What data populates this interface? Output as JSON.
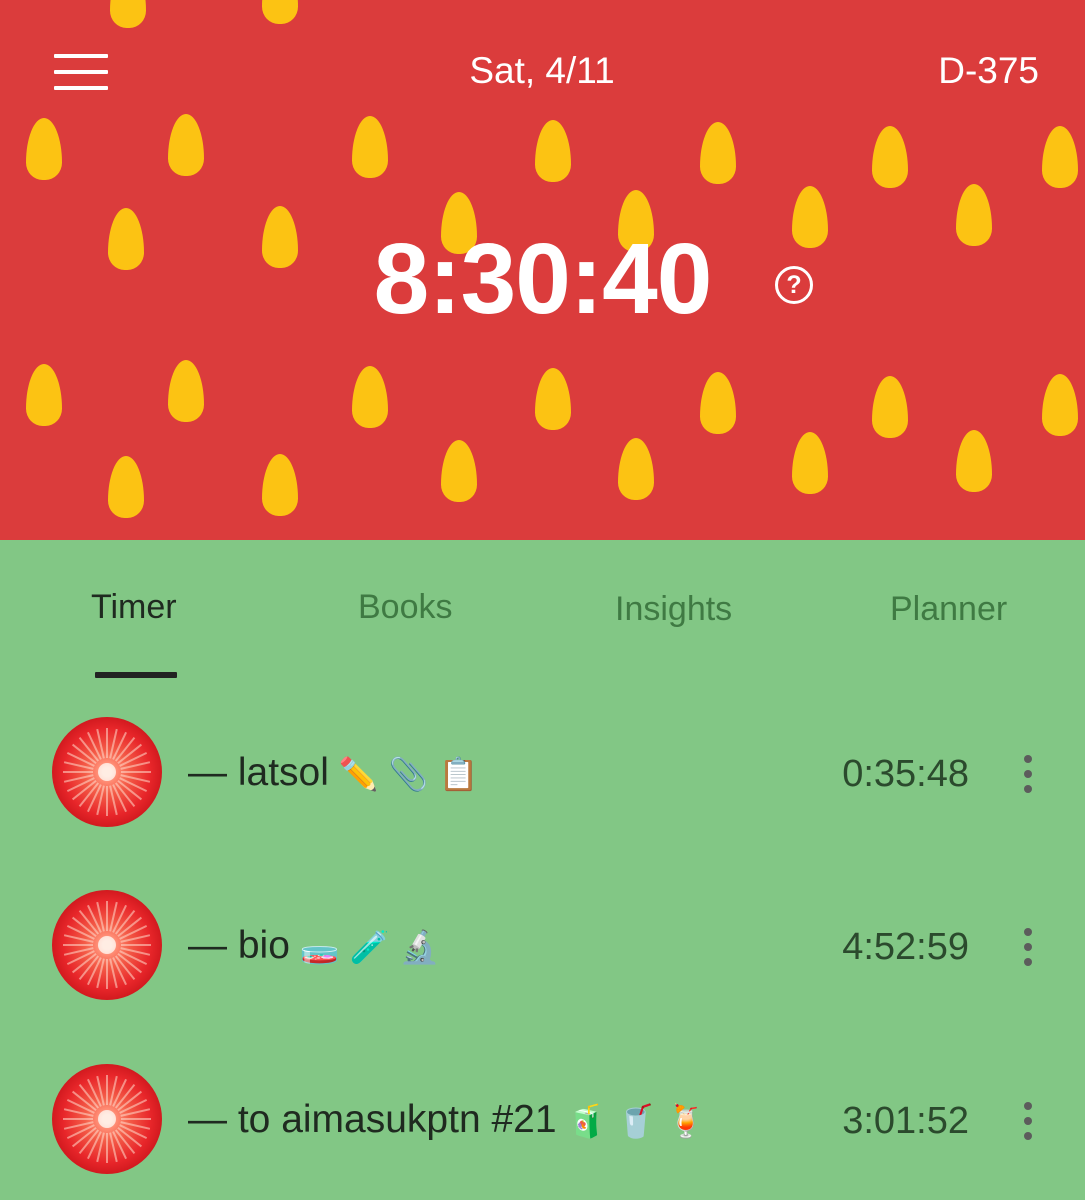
{
  "header": {
    "date": "Sat, 4/11",
    "dday": "D-375",
    "timer": "8:30:40",
    "help_glyph": "?",
    "background_color": "#db3c3c",
    "seed_color": "#fcc313"
  },
  "tabs": [
    {
      "label": "Timer",
      "active": true
    },
    {
      "label": "Books",
      "active": false
    },
    {
      "label": "Insights",
      "active": false
    },
    {
      "label": "Planner",
      "active": false
    }
  ],
  "subjects": [
    {
      "name": "— latsol",
      "emojis": [
        "✏️",
        "📎",
        "📋"
      ],
      "time": "0:35:48",
      "icon": "strawberry-slice-icon"
    },
    {
      "name": "— bio",
      "emojis": [
        "🧫",
        "🧪",
        "🔬"
      ],
      "time": "4:52:59",
      "icon": "strawberry-slice-icon"
    },
    {
      "name": "— to aimasukptn #21",
      "emojis": [
        "🧃",
        "🥤",
        "🍹"
      ],
      "time": "3:01:52",
      "icon": "strawberry-slice-icon"
    }
  ],
  "colors": {
    "list_background": "#82c785",
    "tab_active_indicator": "#222222"
  }
}
